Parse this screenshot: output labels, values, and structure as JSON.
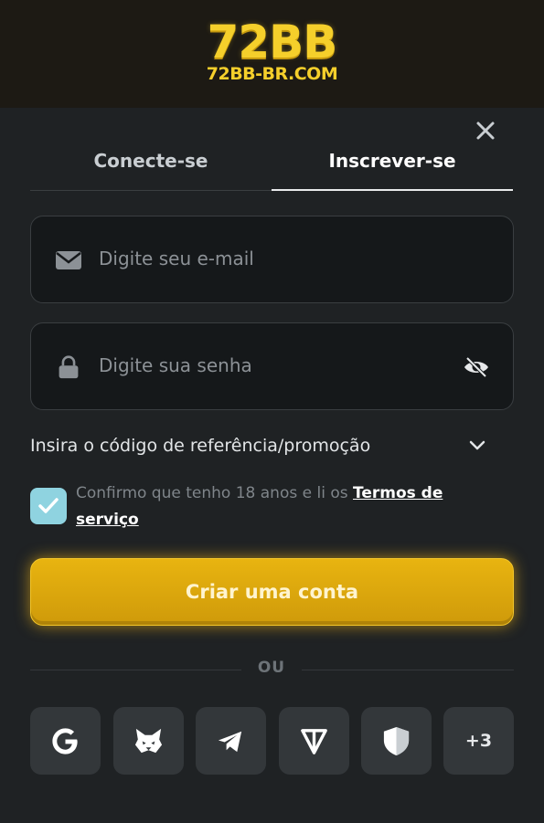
{
  "brand": {
    "logo_text": "72BB",
    "logo_domain": "72BB-BR.COM",
    "color": "#f5cf2b"
  },
  "tabs": [
    {
      "label": "Conecte-se",
      "active": false
    },
    {
      "label": "Inscrever-se",
      "active": true
    }
  ],
  "form": {
    "email": {
      "placeholder": "Digite seu e-mail",
      "value": "",
      "icon": "envelope-icon"
    },
    "password": {
      "placeholder": "Digite sua senha",
      "value": "",
      "icon": "lock-icon",
      "toggle_icon": "eye-off-icon"
    },
    "promo_label": "Insira o código de referência/promoção",
    "terms": {
      "text": "Confirmo que tenho 18 anos e li os ",
      "link": "Termos de serviço",
      "checked": true
    },
    "submit_label": "Criar uma conta"
  },
  "divider_label": "OU",
  "social": [
    {
      "name": "google-icon"
    },
    {
      "name": "metamask-icon"
    },
    {
      "name": "telegram-icon"
    },
    {
      "name": "ton-icon"
    },
    {
      "name": "shield-icon"
    },
    {
      "name": "more",
      "label": "+3"
    }
  ],
  "colors": {
    "accent": "#e8b410",
    "checkbox": "#8fd3e0",
    "background": "#1f2224"
  }
}
